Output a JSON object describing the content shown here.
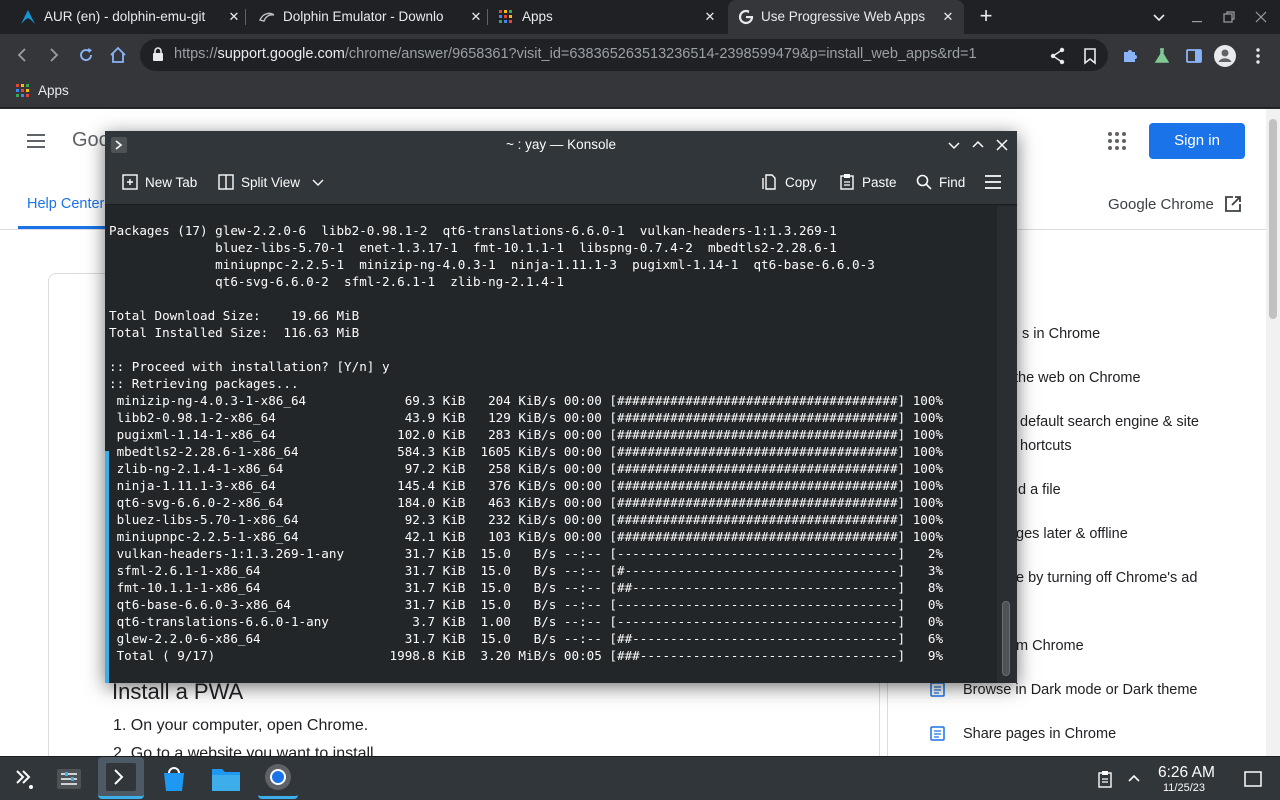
{
  "browser": {
    "tabs": [
      {
        "title": "AUR (en) - dolphin-emu-git",
        "active": false
      },
      {
        "title": "Dolphin Emulator - Downlo",
        "active": false
      },
      {
        "title": "Apps",
        "active": false
      },
      {
        "title": "Use Progressive Web Apps",
        "active": true
      }
    ],
    "new_tab": "+",
    "url_prefix": "https://",
    "url_domain": "support.google.com",
    "url_rest": "/chrome/answer/9658361?visit_id=638365263513236514-2398599479&p=install_web_apps&rd=1",
    "bookmarks": [
      {
        "label": "Apps"
      }
    ]
  },
  "webpage": {
    "logo_partial": "Goo",
    "sign_in": "Sign in",
    "help_center": "Help Center",
    "product": "Google Chrome",
    "install_heading": "Install a PWA",
    "steps": [
      "1. On your computer, open Chrome.",
      "2. Go to a website you want to install."
    ],
    "side_links": [
      {
        "label": "s in Chrome"
      },
      {
        "label": "the web on Chrome"
      },
      {
        "label": "default search engine & site"
      },
      {
        "label": "hortcuts"
      },
      {
        "label": "d a file"
      },
      {
        "label": "ges later & offline"
      },
      {
        "label": "e by turning off Chrome's ad"
      },
      {
        "label": "m Chrome"
      },
      {
        "label": "Browse in Dark mode or Dark theme"
      },
      {
        "label": "Share pages in Chrome"
      }
    ]
  },
  "konsole": {
    "title": "~ : yay — Konsole",
    "toolbar": {
      "new_tab": "New Tab",
      "split_view": "Split View",
      "copy": "Copy",
      "paste": "Paste",
      "find": "Find"
    },
    "lines": [
      "Packages (17) glew-2.2.0-6  libb2-0.98.1-2  qt6-translations-6.6.0-1  vulkan-headers-1:1.3.269-1",
      "              bluez-libs-5.70-1  enet-1.3.17-1  fmt-10.1.1-1  libspng-0.7.4-2  mbedtls2-2.28.6-1",
      "              miniupnpc-2.2.5-1  minizip-ng-4.0.3-1  ninja-1.11.1-3  pugixml-1.14-1  qt6-base-6.6.0-3",
      "              qt6-svg-6.6.0-2  sfml-2.6.1-1  zlib-ng-2.1.4-1",
      "",
      "Total Download Size:    19.66 MiB",
      "Total Installed Size:  116.63 MiB",
      "",
      ":: Proceed with installation? [Y/n] y",
      ":: Retrieving packages...",
      " minizip-ng-4.0.3-1-x86_64             69.3 KiB   204 KiB/s 00:00 [#####################################] 100%",
      " libb2-0.98.1-2-x86_64                 43.9 KiB   129 KiB/s 00:00 [#####################################] 100%",
      " pugixml-1.14-1-x86_64                102.0 KiB   283 KiB/s 00:00 [#####################################] 100%",
      " mbedtls2-2.28.6-1-x86_64             584.3 KiB  1605 KiB/s 00:00 [#####################################] 100%",
      " zlib-ng-2.1.4-1-x86_64                97.2 KiB   258 KiB/s 00:00 [#####################################] 100%",
      " ninja-1.11.1-3-x86_64                145.4 KiB   376 KiB/s 00:00 [#####################################] 100%",
      " qt6-svg-6.6.0-2-x86_64               184.0 KiB   463 KiB/s 00:00 [#####################################] 100%",
      " bluez-libs-5.70-1-x86_64              92.3 KiB   232 KiB/s 00:00 [#####################################] 100%",
      " miniupnpc-2.2.5-1-x86_64              42.1 KiB   103 KiB/s 00:00 [#####################################] 100%",
      " vulkan-headers-1:1.3.269-1-any        31.7 KiB  15.0   B/s --:-- [-------------------------------------]   2%",
      " sfml-2.6.1-1-x86_64                   31.7 KiB  15.0   B/s --:-- [#------------------------------------]   3%",
      " fmt-10.1.1-1-x86_64                   31.7 KiB  15.0   B/s --:-- [##-----------------------------------]   8%",
      " qt6-base-6.6.0-3-x86_64               31.7 KiB  15.0   B/s --:-- [-------------------------------------]   0%",
      " qt6-translations-6.6.0-1-any           3.7 KiB  1.00   B/s --:-- [-------------------------------------]   0%",
      " glew-2.2.0-6-x86_64                   31.7 KiB  15.0   B/s --:-- [##-----------------------------------]   6%",
      " Total ( 9/17)                       1998.8 KiB  3.20 MiB/s 00:05 [###----------------------------------]   9%"
    ]
  },
  "taskbar": {
    "time": "6:26 AM",
    "date": "11/25/23"
  },
  "colors": {
    "chrome_dark": "#202124",
    "chrome_toolbar": "#35363a",
    "google_blue": "#1a73e8",
    "konsole_bg": "#232629",
    "breeze_blue": "#3daee9"
  }
}
